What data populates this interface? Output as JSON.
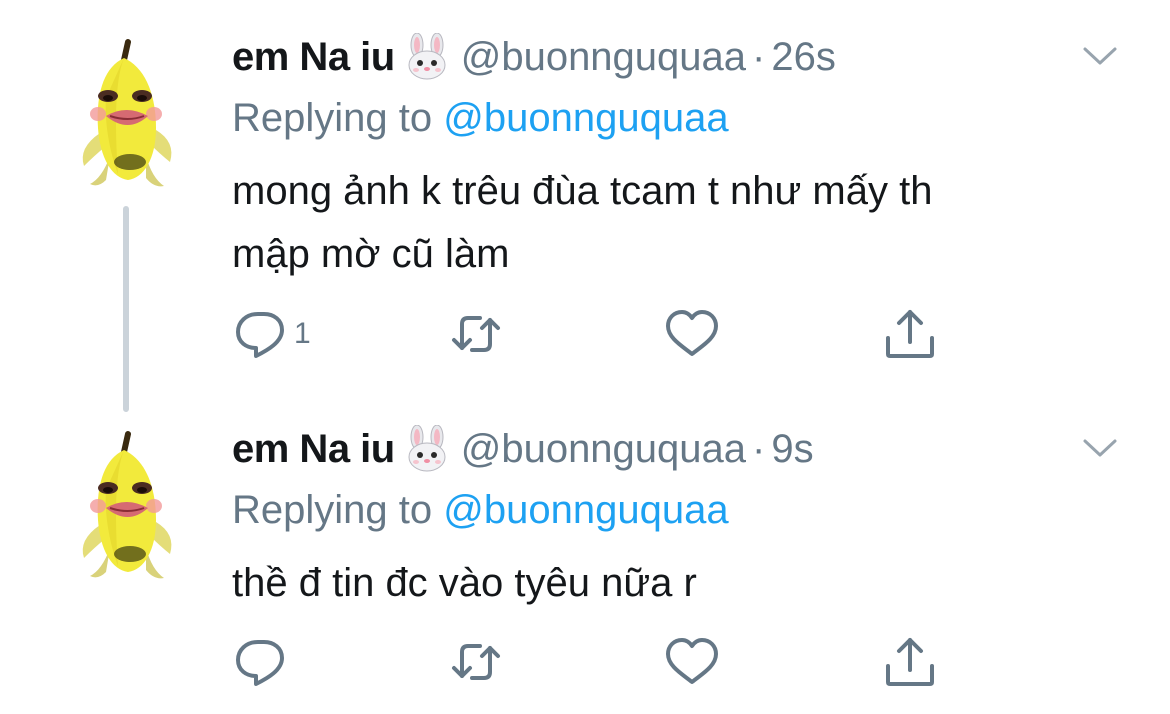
{
  "tweets": [
    {
      "name": "em Na iu",
      "name_emoji": "rabbit-face-icon",
      "handle": "@buonnguquaa",
      "separator": "·",
      "time": "26s",
      "replying_label": "Replying to",
      "replying_handle": "@buonnguquaa",
      "text_line1": "mong ảnh k trêu đùa tcam t như mấy th",
      "text_line2": "mập mờ cũ làm",
      "reply_count": "1"
    },
    {
      "name": "em Na iu",
      "name_emoji": "rabbit-face-icon",
      "handle": "@buonnguquaa",
      "separator": "·",
      "time": "9s",
      "replying_label": "Replying to",
      "replying_handle": "@buonnguquaa",
      "text_line1": "thề đ tin đc vào tyêu nữa r",
      "reply_count": ""
    }
  ],
  "colors": {
    "text": "#14171a",
    "secondary": "#657786",
    "link": "#1da1f2",
    "thread_line": "#cbd3da"
  }
}
